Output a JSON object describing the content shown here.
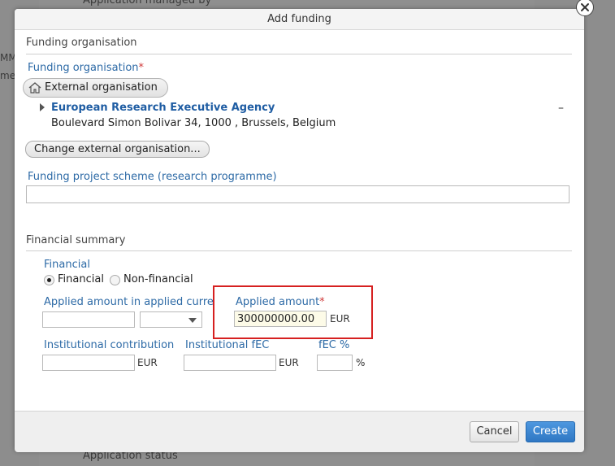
{
  "background": {
    "top_text": "Application managed by",
    "bottom_text": "Application status",
    "left_text_1": "MM",
    "left_text_2": "me"
  },
  "dialog": {
    "title": "Add funding",
    "funding_organisation_section": {
      "heading": "Funding organisation",
      "label": "Funding organisation",
      "required_mark": "*",
      "external_pill": "External organisation",
      "org_name": "European Research Executive Agency",
      "org_address": "Boulevard Simon Bolivar 34, 1000 , Brussels, Belgium",
      "collapse_symbol": "–",
      "change_button": "Change external organisation...",
      "scheme_label": "Funding project scheme (research programme)",
      "scheme_value": ""
    },
    "financial_summary": {
      "heading": "Financial summary",
      "financial_label": "Financial",
      "radio_options": [
        {
          "label": "Financial",
          "checked": true
        },
        {
          "label": "Non-financial",
          "checked": false
        }
      ],
      "applied_currency_label": "Applied amount in applied currency",
      "applied_currency_value": "",
      "applied_currency_select": "",
      "applied_amount_label": "Applied amount",
      "applied_amount_value": "300000000.00",
      "applied_amount_unit": "EUR",
      "institutional_contribution_label": "Institutional contribution",
      "institutional_contribution_value": "",
      "institutional_contribution_unit": "EUR",
      "institutional_fec_label": "Institutional fEC",
      "institutional_fec_value": "",
      "institutional_fec_unit": "EUR",
      "fec_percent_label": "fEC %",
      "fec_percent_value": "",
      "fec_percent_unit": "%"
    },
    "footer": {
      "cancel_label": "Cancel",
      "create_label": "Create"
    }
  },
  "colors": {
    "label_blue": "#2d6aa6",
    "org_link": "#1f5da3",
    "required": "#d03a3a",
    "highlight_box": "#d62020",
    "primary_button": "#2f77c3"
  }
}
